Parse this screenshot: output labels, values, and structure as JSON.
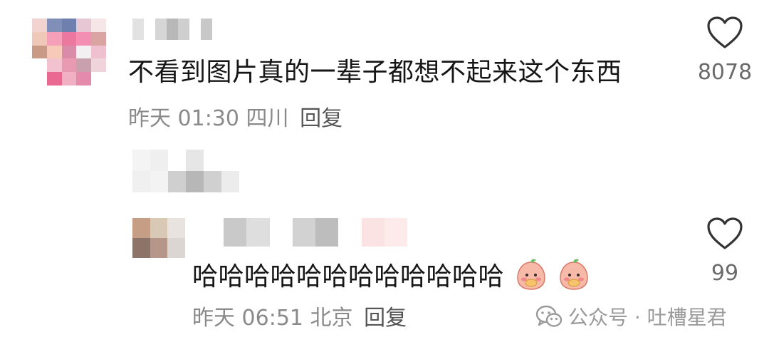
{
  "comments": [
    {
      "text": "不看到图片真的一辈子都想不起来这个东西",
      "time": "昨天 01:30",
      "location": "四川",
      "reply_label": "回复",
      "likes": "8078"
    }
  ],
  "replies": [
    {
      "text": "哈哈哈哈哈哈哈哈哈哈哈哈",
      "emoji_icons": [
        "peach-face-emoji",
        "peach-face-emoji"
      ],
      "time": "昨天 06:51",
      "location": "北京",
      "reply_label": "回复",
      "likes": "99"
    }
  ],
  "watermark": {
    "text": "公众号 · 吐槽星君",
    "icon": "wechat-icon"
  },
  "colors": {
    "text": "#161616",
    "meta": "#8a8a8a",
    "heart_stroke": "#333333"
  }
}
